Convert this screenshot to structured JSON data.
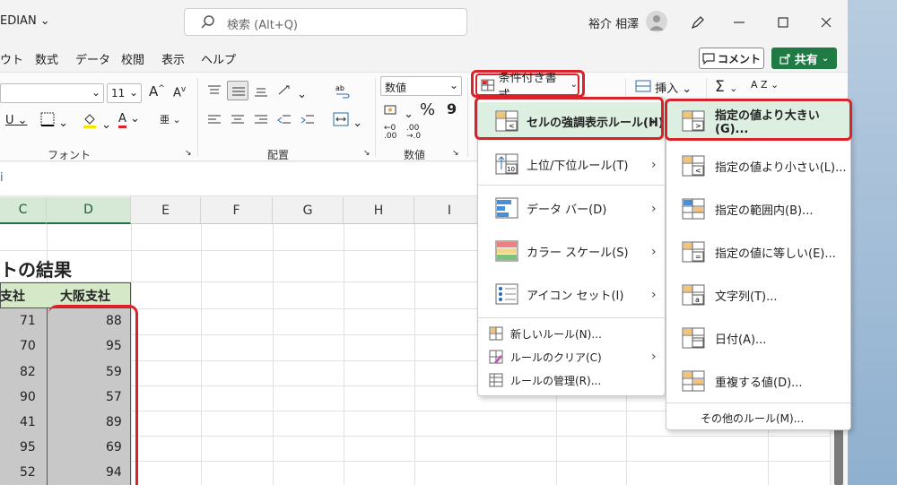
{
  "titlebar": {
    "app_title": "EDIAN ⌄",
    "search_placeholder": "検索 (Alt+Q)",
    "user_name": "裕介 相澤"
  },
  "menu": {
    "items": [
      "ウト",
      "数式",
      "データ",
      "校閲",
      "表示",
      "ヘルプ"
    ],
    "comment_label": "コメント",
    "share_label": "共有"
  },
  "ribbon": {
    "font_size": "11",
    "font_group": "フォント",
    "align_group": "配置",
    "number_group": "数値",
    "number_format": "数値",
    "conditional_format": "条件付き書式",
    "insert_label": "挿入",
    "font_grow": "A",
    "font_shrink": "A",
    "underline": "U",
    "font_color": "A",
    "percent": "%",
    "comma": "9",
    "sum": "Σ",
    "sort": "A Z"
  },
  "grid": {
    "columns": [
      "C",
      "D",
      "E",
      "F",
      "G",
      "H",
      "I"
    ],
    "title_text": "トの結果",
    "header_c": "支社",
    "header_d": "大阪支社",
    "values_c": [
      "71",
      "70",
      "82",
      "90",
      "41",
      "95",
      "52"
    ],
    "values_d": [
      "88",
      "95",
      "59",
      "57",
      "89",
      "69",
      "94"
    ],
    "formula_fragment": "i"
  },
  "cf_menu": {
    "items": [
      {
        "label": "セルの強調表示ルール(H)"
      },
      {
        "label": "上位/下位ルール(T)"
      },
      {
        "label": "データ バー(D)"
      },
      {
        "label": "カラー スケール(S)"
      },
      {
        "label": "アイコン セット(I)"
      }
    ],
    "small_items": [
      {
        "label": "新しいルール(N)..."
      },
      {
        "label": "ルールのクリア(C)"
      },
      {
        "label": "ルールの管理(R)..."
      }
    ]
  },
  "sub_menu": {
    "items": [
      {
        "label": "指定の値より大きい(G)..."
      },
      {
        "label": "指定の値より小さい(L)..."
      },
      {
        "label": "指定の範囲内(B)..."
      },
      {
        "label": "指定の値に等しい(E)..."
      },
      {
        "label": "文字列(T)..."
      },
      {
        "label": "日付(A)..."
      },
      {
        "label": "重複する値(D)..."
      }
    ],
    "more": "その他のルール(M)..."
  },
  "colors": {
    "accent_green": "#217346",
    "highlight_red": "#d8232a",
    "active_item": "#dcefe1",
    "selected_cells": "#c8c8c8",
    "header_fill": "#d5e8c8"
  }
}
